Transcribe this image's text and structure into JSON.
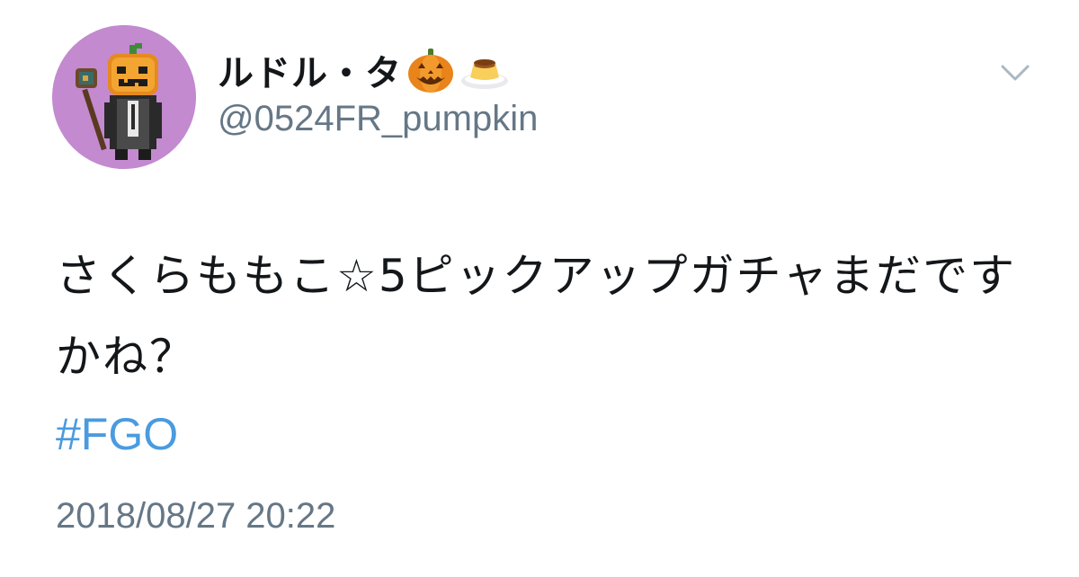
{
  "tweet": {
    "author": {
      "display_name": "ルドル・タ",
      "name_emojis": [
        "jack-o-lantern",
        "custard-pudding"
      ],
      "handle": "@0524FR_pumpkin",
      "avatar": "pixel-art pumpkin-head character"
    },
    "text": "さくらももこ☆5ピックアップガチャまだですかね？",
    "hashtag": "#FGO",
    "timestamp": "2018/08/27 20:22",
    "menu_icon": "chevron-down-icon"
  },
  "colors": {
    "text": "#14171a",
    "secondary": "#657786",
    "link": "#4a9be0",
    "avatar_bg": "#c38ad0",
    "background": "#ffffff"
  }
}
